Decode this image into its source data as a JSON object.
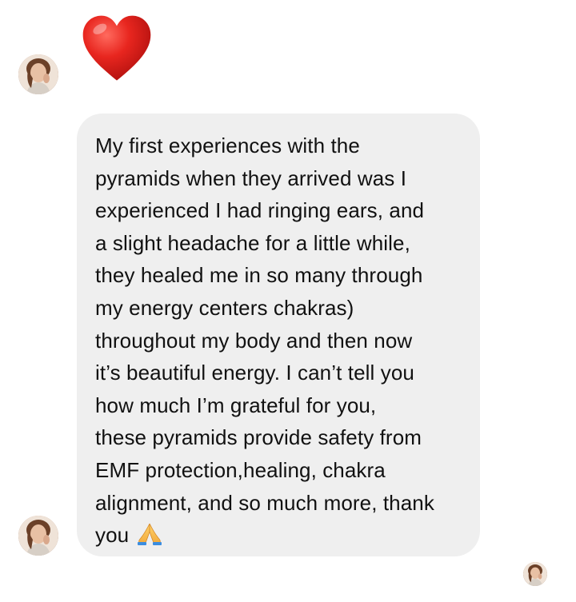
{
  "conversation": {
    "reaction": {
      "icon": "red-heart-icon",
      "color": "#e0201f"
    },
    "message": {
      "text": "My first experiences with the\npyramids when they arrived was I\nexperienced I had ringing ears, and\na slight headache for a little while,\nthey healed me in so many through\nmy energy centers chakras)\nthroughout my body and then now\nit’s beautiful energy. I can’t tell you\nhow much I’m grateful for you,\nthese pyramids provide safety from\nEMF protection,healing, chakra\nalignment, and so much more, thank\nyou",
      "trailing_icon": "folded-hands-icon",
      "bubble_color": "#efefef"
    },
    "read_receipt": {
      "icon": "avatar"
    }
  }
}
